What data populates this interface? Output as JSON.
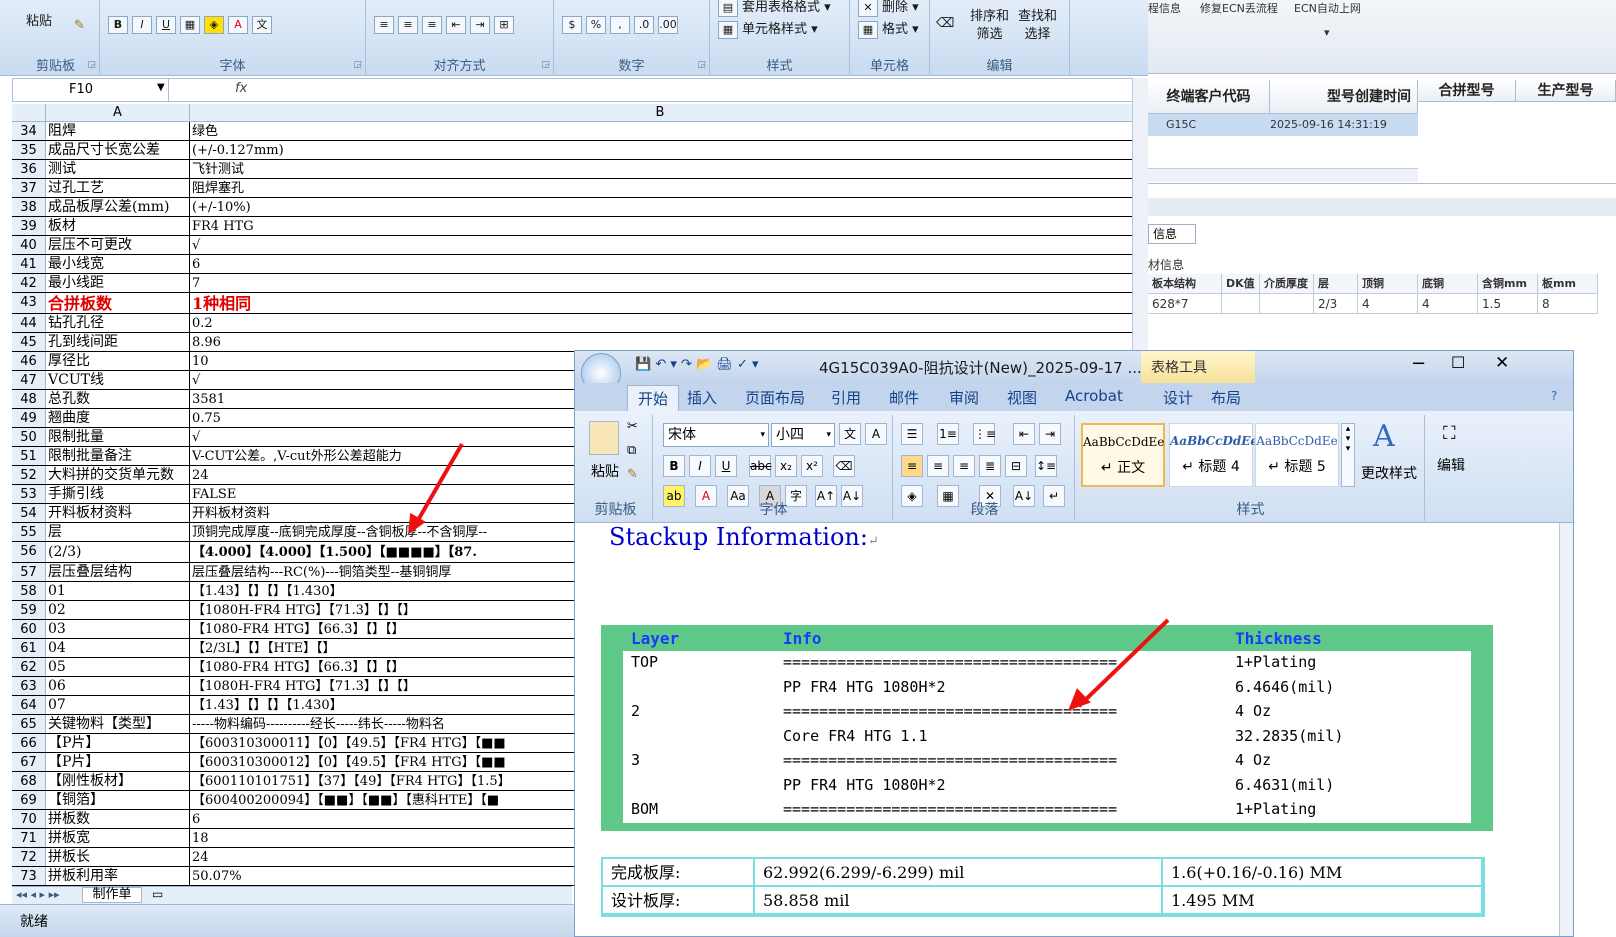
{
  "excel": {
    "ribbon": {
      "paste": "粘贴",
      "clipboard": "剪贴板",
      "font": "字体",
      "align": "对齐方式",
      "number": "数字",
      "styles": "样式",
      "cells": "单元格",
      "edit": "编辑",
      "table_format": "套用表格格式",
      "cell_style": "单元格样式",
      "delete": "删除",
      "format": "格式",
      "sort_filter": "排序和\n筛选",
      "find_select": "查找和\n选择"
    },
    "name_box": "F10",
    "fx": "fx",
    "col_a": "A",
    "col_b": "B",
    "rows": [
      {
        "n": "34",
        "a": "阻焊",
        "b": "绿色"
      },
      {
        "n": "35",
        "a": "成品尺寸长宽公差",
        "b": "(+/-0.127mm)"
      },
      {
        "n": "36",
        "a": "测试",
        "b": "飞针测试"
      },
      {
        "n": "37",
        "a": "过孔工艺",
        "b": "阻焊塞孔"
      },
      {
        "n": "38",
        "a": "成品板厚公差(mm)",
        "b": "(+/-10%)"
      },
      {
        "n": "39",
        "a": "板材",
        "b": "FR4 HTG"
      },
      {
        "n": "40",
        "a": "层压不可更改",
        "b": "√"
      },
      {
        "n": "41",
        "a": "最小线宽",
        "b": "6"
      },
      {
        "n": "42",
        "a": "最小线距",
        "b": "7"
      },
      {
        "n": "43",
        "a": "合拼板数",
        "b": "1种相同"
      },
      {
        "n": "44",
        "a": "钻孔孔径",
        "b": "0.2"
      },
      {
        "n": "45",
        "a": "孔到线间距",
        "b": "8.96"
      },
      {
        "n": "46",
        "a": "厚径比",
        "b": "10"
      },
      {
        "n": "47",
        "a": "VCUT线",
        "b": "√"
      },
      {
        "n": "48",
        "a": "总孔数",
        "b": "3581"
      },
      {
        "n": "49",
        "a": "翘曲度",
        "b": "0.75"
      },
      {
        "n": "50",
        "a": "限制批量",
        "b": "√"
      },
      {
        "n": "51",
        "a": "限制批量备注",
        "b": "V-CUT公差。,V-cut外形公差超能力"
      },
      {
        "n": "52",
        "a": "大料拼的交货单元数",
        "b": "24"
      },
      {
        "n": "53",
        "a": "手撕引线",
        "b": "FALSE"
      },
      {
        "n": "54",
        "a": "开料板材资料",
        "b": "开料板材资料"
      },
      {
        "n": "55",
        "a": "层",
        "b": "顶铜完成厚度--底铜完成厚度--含铜板厚--不含铜厚--"
      },
      {
        "n": "56",
        "a": "(2/3)",
        "b": "【4.000】【4.000】【1.500】【■■■■】【87."
      },
      {
        "n": "57",
        "a": "层压叠层结构",
        "b": "层压叠层结构---RC(%)---铜箔类型--基铜铜厚"
      },
      {
        "n": "58",
        "a": "01",
        "b": "【1.43】【】【】【1.430】"
      },
      {
        "n": "59",
        "a": "02",
        "b": "【1080H-FR4 HTG】【71.3】【】【】"
      },
      {
        "n": "60",
        "a": "03",
        "b": "【1080-FR4 HTG】【66.3】【】【】"
      },
      {
        "n": "61",
        "a": "04",
        "b": "【2/3L】【】【HTE】【】"
      },
      {
        "n": "62",
        "a": "05",
        "b": "【1080-FR4 HTG】【66.3】【】【】"
      },
      {
        "n": "63",
        "a": "06",
        "b": "【1080H-FR4 HTG】【71.3】【】【】"
      },
      {
        "n": "64",
        "a": "07",
        "b": "【1.43】【】【】【1.430】"
      },
      {
        "n": "65",
        "a": "关键物料【类型】",
        "b": "-----物料编码----------经长-----纬长-----物料名"
      },
      {
        "n": "66",
        "a": "【P片】",
        "b": "【600310300011】【0】【49.5】【FR4 HTG】【■■"
      },
      {
        "n": "67",
        "a": "【P片】",
        "b": "【600310300012】【0】【49.5】【FR4 HTG】【■■"
      },
      {
        "n": "68",
        "a": "【刚性板材】",
        "b": "【600110101751】【37】【49】【FR4 HTG】【1.5】"
      },
      {
        "n": "69",
        "a": "【铜箔】",
        "b": "【600400200094】【■■】【■■】【惠科HTE】【■"
      },
      {
        "n": "70",
        "a": "拼板数",
        "b": "6"
      },
      {
        "n": "71",
        "a": "拼板宽",
        "b": "18"
      },
      {
        "n": "72",
        "a": "拼板长",
        "b": "24"
      },
      {
        "n": "73",
        "a": "拼板利用率",
        "b": "50.07%"
      }
    ],
    "sheet_tab": "制作单",
    "status": "就绪"
  },
  "bgapp": {
    "menu": [
      "程信息",
      "修复ECN丢流程",
      "ECN自动上网"
    ],
    "headers": [
      "终端客户代码",
      "型号创建时间",
      "合拼型号",
      "生产型号"
    ],
    "row": {
      "code": "G15C",
      "time": "2025-09-16 14:31:19"
    },
    "info_tab": "信息",
    "material_info": "材信息",
    "mat_headers": [
      "板本结构",
      "DK值",
      "介质厚度",
      "层",
      "顶铜",
      "底铜",
      "含铜mm",
      "板mm"
    ],
    "mat_row": [
      "628*7",
      "",
      "",
      "2/3",
      "4",
      "4",
      "1.5",
      "8"
    ]
  },
  "word": {
    "title": "4G15C039A0-阻抗设计(New)_2025-09-17 ...",
    "table_tools": "表格工具",
    "tabs": [
      "开始",
      "插入",
      "页面布局",
      "引用",
      "邮件",
      "审阅",
      "视图",
      "Acrobat",
      "设计",
      "布局"
    ],
    "font_name": "宋体",
    "font_size": "小四",
    "groups": {
      "clipboard": "剪贴板",
      "font": "字体",
      "paragraph": "段落",
      "styles": "样式"
    },
    "paste": "粘贴",
    "styles": [
      {
        "preview": "AaBbCcDdEe",
        "name": "↵ 正文"
      },
      {
        "preview": "AaBbCcDdEe",
        "name": "↵ 标题 4"
      },
      {
        "preview": "AaBbCcDdEe",
        "name": "↵ 标题 5"
      }
    ],
    "change_styles": "更改样式",
    "edit": "编辑",
    "doc_title": "Stackup Information:",
    "stack_headers": {
      "layer": "Layer",
      "info": "Info",
      "thickness": "Thickness"
    },
    "stack_rows": [
      {
        "layer": "TOP",
        "info": "=====================================",
        "thick": "1+Plating"
      },
      {
        "layer": "",
        "info": "PP    FR4 HTG    1080H*2",
        "thick": "6.4646(mil)"
      },
      {
        "layer": "2",
        "info": "=====================================",
        "thick": "4 Oz"
      },
      {
        "layer": "",
        "info": "Core    FR4 HTG    1.1",
        "thick": "32.2835(mil)"
      },
      {
        "layer": "3",
        "info": "=====================================",
        "thick": "4 Oz"
      },
      {
        "layer": "",
        "info": "PP    FR4 HTG    1080H*2",
        "thick": "6.4631(mil)"
      },
      {
        "layer": "BOM",
        "info": "=====================================",
        "thick": "1+Plating"
      }
    ],
    "bottom_rows": [
      {
        "label": "完成板厚:",
        "mil": "62.992(6.299/-6.299) mil",
        "mm": "1.6(+0.16/-0.16) MM"
      },
      {
        "label": "设计板厚:",
        "mil": "58.858 mil",
        "mm": "1.495 MM"
      }
    ]
  },
  "colors": {
    "accent_red": "#e00000",
    "stack_green": "#5fc98a",
    "stack_blue": "#1a3aff",
    "table_cyan": "#78e0e0"
  }
}
